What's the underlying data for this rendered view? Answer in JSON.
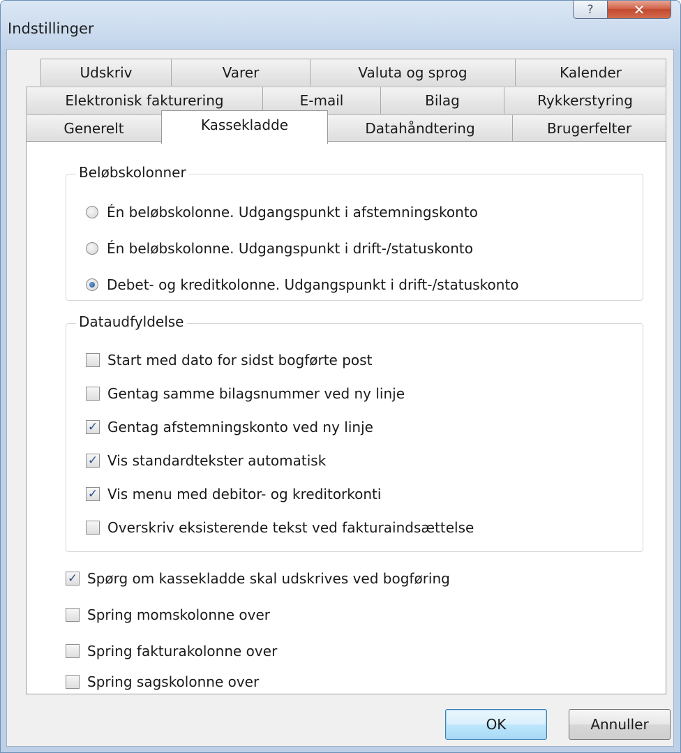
{
  "window": {
    "title": "Indstillinger",
    "help_glyph": "?",
    "close_glyph": "✕"
  },
  "tabs": {
    "row1": [
      "Udskriv",
      "Varer",
      "Valuta og sprog",
      "Kalender"
    ],
    "row2": [
      "Elektronisk fakturering",
      "E-mail",
      "Bilag",
      "Rykkerstyring"
    ],
    "row3": [
      "Generelt",
      "Kassekladde",
      "Datahåndtering",
      "Brugerfelter"
    ],
    "active": "Kassekladde"
  },
  "belobskolonner": {
    "title": "Beløbskolonner",
    "options": [
      {
        "label": "Én beløbskolonne. Udgangspunkt i afstemningskonto",
        "selected": false
      },
      {
        "label": "Én beløbskolonne. Udgangspunkt i drift-/statuskonto",
        "selected": false
      },
      {
        "label": "Debet- og kreditkolonne. Udgangspunkt i drift-/statuskonto",
        "selected": true
      }
    ]
  },
  "dataudfyldelse": {
    "title": "Dataudfyldelse",
    "options": [
      {
        "label": "Start med dato for sidst bogførte post",
        "checked": false
      },
      {
        "label": "Gentag samme bilagsnummer ved ny linje",
        "checked": false
      },
      {
        "label": "Gentag afstemningskonto ved ny linje",
        "checked": true
      },
      {
        "label": "Vis standardtekster automatisk",
        "checked": true
      },
      {
        "label": "Vis menu med debitor- og kreditorkonti",
        "checked": true
      },
      {
        "label": "Overskriv eksisterende tekst ved fakturaindsættelse",
        "checked": false
      }
    ]
  },
  "extra_options": [
    {
      "label": "Spørg om kassekladde skal udskrives ved bogføring",
      "checked": true
    },
    {
      "label": "Spring momskolonne over",
      "checked": false
    },
    {
      "label": "Spring fakturakolonne over",
      "checked": false
    },
    {
      "label": "Spring sagskolonne over",
      "checked": false
    }
  ],
  "buttons": {
    "ok": "OK",
    "cancel": "Annuller"
  }
}
